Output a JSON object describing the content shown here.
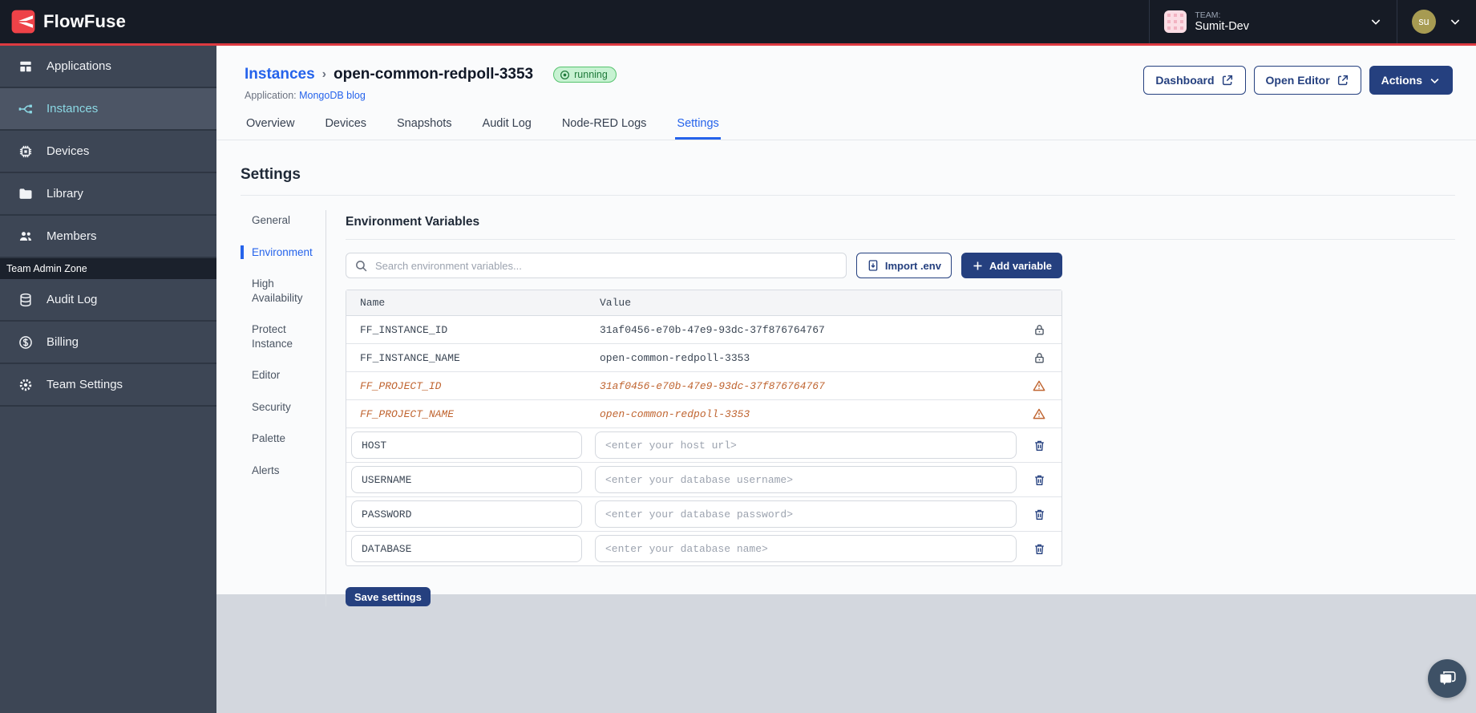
{
  "navbar": {
    "brand": "FlowFuse",
    "team_label": "TEAM:",
    "team_name": "Sumit-Dev",
    "user_initials": "su"
  },
  "sidebar": {
    "items": [
      {
        "label": "Applications",
        "icon": "applications-icon",
        "active": false
      },
      {
        "label": "Instances",
        "icon": "instances-icon",
        "active": true
      },
      {
        "label": "Devices",
        "icon": "devices-icon",
        "active": false
      },
      {
        "label": "Library",
        "icon": "library-icon",
        "active": false
      },
      {
        "label": "Members",
        "icon": "members-icon",
        "active": false
      }
    ],
    "admin_zone_label": "Team Admin Zone",
    "admin_items": [
      {
        "label": "Audit Log",
        "icon": "audit-log-icon",
        "active": false
      },
      {
        "label": "Billing",
        "icon": "billing-icon",
        "active": false
      },
      {
        "label": "Team Settings",
        "icon": "team-settings-icon",
        "active": false
      }
    ]
  },
  "header": {
    "breadcrumb_root": "Instances",
    "breadcrumb_separator": "›",
    "instance_name": "open-common-redpoll-3353",
    "status": "running",
    "application_label": "Application:",
    "application_name": "MongoDB blog",
    "dashboard_label": "Dashboard",
    "open_editor_label": "Open Editor",
    "actions_label": "Actions"
  },
  "tabs": [
    {
      "label": "Overview",
      "active": false
    },
    {
      "label": "Devices",
      "active": false
    },
    {
      "label": "Snapshots",
      "active": false
    },
    {
      "label": "Audit Log",
      "active": false
    },
    {
      "label": "Node-RED Logs",
      "active": false
    },
    {
      "label": "Settings",
      "active": true
    }
  ],
  "settings": {
    "title": "Settings",
    "nav": [
      {
        "label": "General",
        "active": false
      },
      {
        "label": "Environment",
        "active": true
      },
      {
        "label": "High Availability",
        "active": false
      },
      {
        "label": "Protect Instance",
        "active": false
      },
      {
        "label": "Editor",
        "active": false
      },
      {
        "label": "Security",
        "active": false
      },
      {
        "label": "Palette",
        "active": false
      },
      {
        "label": "Alerts",
        "active": false
      }
    ]
  },
  "env": {
    "title": "Environment Variables",
    "search_placeholder": "Search environment variables...",
    "import_label": "Import .env",
    "add_label": "Add variable",
    "columns": {
      "name": "Name",
      "value": "Value"
    },
    "rows": [
      {
        "type": "locked",
        "name": "FF_INSTANCE_ID",
        "value": "31af0456-e70b-47e9-93dc-37f876764767"
      },
      {
        "type": "locked",
        "name": "FF_INSTANCE_NAME",
        "value": "open-common-redpoll-3353"
      },
      {
        "type": "warning",
        "name": "FF_PROJECT_ID",
        "value": "31af0456-e70b-47e9-93dc-37f876764767"
      },
      {
        "type": "warning",
        "name": "FF_PROJECT_NAME",
        "value": "open-common-redpoll-3353"
      },
      {
        "type": "editable",
        "name": "HOST",
        "placeholder": "<enter your host url>"
      },
      {
        "type": "editable",
        "name": "USERNAME",
        "placeholder": "<enter your database username>"
      },
      {
        "type": "editable",
        "name": "PASSWORD",
        "placeholder": "<enter your database password>"
      },
      {
        "type": "editable",
        "name": "DATABASE",
        "placeholder": "<enter your database name>"
      }
    ],
    "save_label": "Save settings"
  },
  "colors": {
    "accent_red": "#dd3a41",
    "navy_button": "#25407f",
    "link_blue": "#2563eb",
    "sidebar_bg": "#3d4655",
    "sidebar_active_text": "#8bd8e4",
    "status_green_bg": "#c7f2d2",
    "status_green_text": "#1f7a3a",
    "warning_orange": "#c06531",
    "footer_gray": "#d3d7de"
  }
}
